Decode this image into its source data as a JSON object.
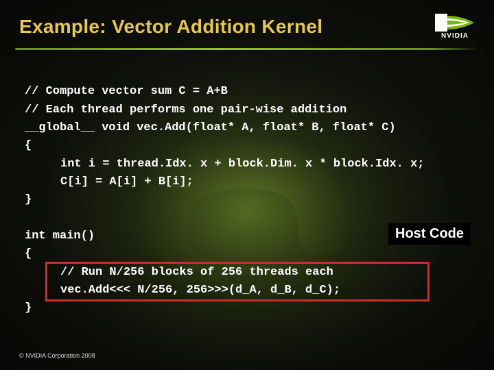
{
  "title": "Example: Vector Addition Kernel",
  "logo": {
    "brand": "NVIDIA"
  },
  "code": {
    "l1": "// Compute vector sum C = A+B",
    "l2": "// Each thread performs one pair-wise addition",
    "l3": "__global__ void vec.Add(float* A, float* B, float* C)",
    "l4": "{",
    "l5": "int i = thread.Idx. x + block.Dim. x * block.Idx. x;",
    "l6": "C[i] = A[i] + B[i];",
    "l7": "}",
    "l8": "int main()",
    "l9": "{",
    "l10": "// Run N/256 blocks of 256 threads each",
    "l11": "vec.Add<<< N/256, 256>>>(d_A, d_B, d_C);",
    "l12": "}"
  },
  "host_label": "Host Code",
  "copyright": "© NVIDIA Corporation 2008"
}
